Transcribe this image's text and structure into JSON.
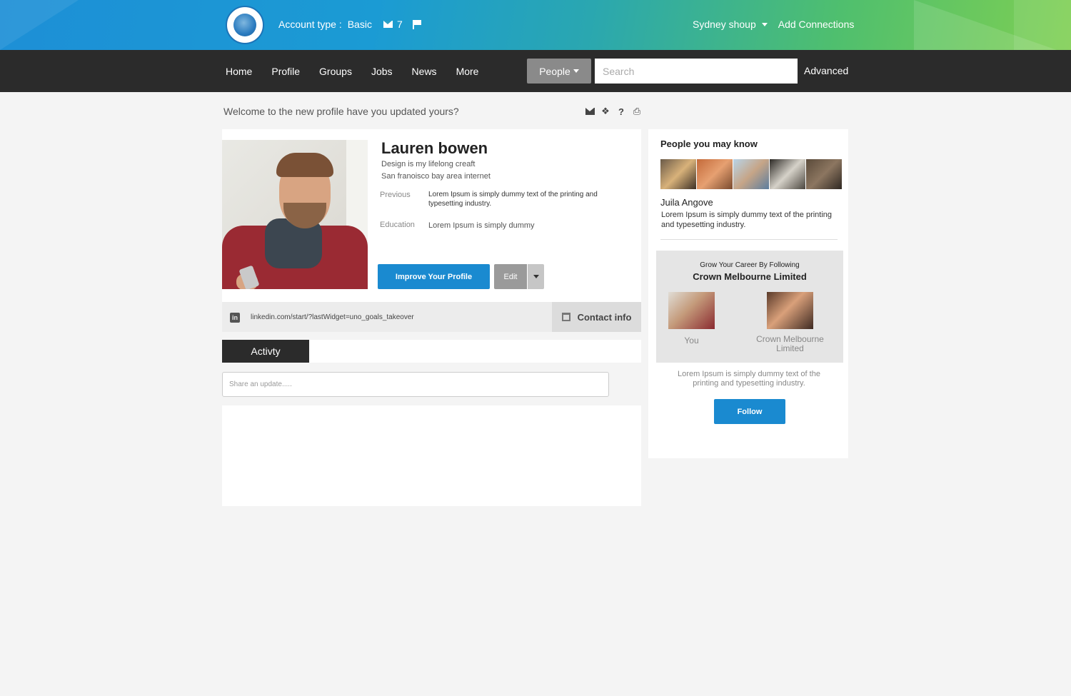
{
  "header": {
    "account_type_label": "Account type :",
    "account_type_value": "Basic",
    "message_count": "7",
    "user_menu_label": "Sydney shoup",
    "add_connections_label": "Add Connections"
  },
  "nav": {
    "items": [
      "Home",
      "Profile",
      "Groups",
      "Jobs",
      "News",
      "More"
    ],
    "search_scope": "People",
    "search_placeholder": "Search",
    "advanced_label": "Advanced"
  },
  "welcome": {
    "text": "Welcome to the new profile have you updated yours?",
    "tools": [
      "mail-icon",
      "share-icon",
      "help-icon",
      "print-icon"
    ]
  },
  "profile": {
    "name": "Lauren bowen",
    "tagline": "Design is my lifelong creaft",
    "location": "San franoisco bay area internet",
    "previous_label": "Previous",
    "previous_text": "Lorem Ipsum is simply dummy text of the printing and typesetting industry.",
    "education_label": "Education",
    "education_text": "Lorem Ipsum is simply dummy",
    "improve_label": "Improve Your Profile",
    "edit_label": "Edit",
    "link_url": "linkedin.com/start/?lastWidget=uno_goals_takeover",
    "contact_label": "Contact info"
  },
  "activity": {
    "tab_label": "Activty",
    "share_placeholder": "Share an update....."
  },
  "sidebar": {
    "people_title": "People you may know",
    "person_name": "Juila Angove",
    "person_desc": "Lorem Ipsum is simply dummy text of the printing and typesetting industry.",
    "grow_small": "Grow Your Career By Following",
    "grow_company": "Crown Melbourne Limited",
    "you_label": "You",
    "company_label": "Crown Melbourne Limited",
    "company_desc": "Lorem Ipsum is simply dummy text of the printing and typesetting industry.",
    "follow_label": "Follow"
  },
  "colors": {
    "accent_blue": "#1a8ad0",
    "nav_dark": "#2b2b2b"
  }
}
